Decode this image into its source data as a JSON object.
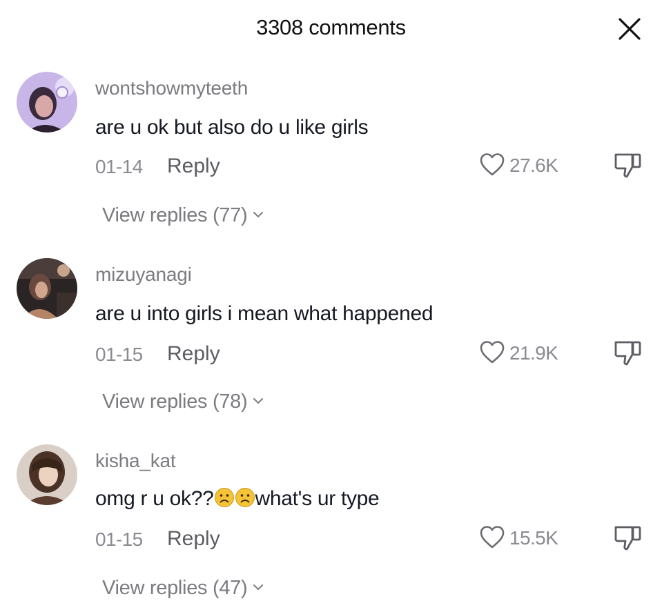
{
  "header": {
    "title": "3308 comments",
    "close_icon": "close-icon"
  },
  "comments": [
    {
      "username": "wontshowmyteeth",
      "text": "are u ok but also do u like girls",
      "date": "01-14",
      "reply_label": "Reply",
      "likes": "27.6K",
      "view_replies": "View replies (77)",
      "avatar_icon": "avatar-photo"
    },
    {
      "username": "mizuyanagi",
      "text": "are u into girls i mean what happened",
      "date": "01-15",
      "reply_label": "Reply",
      "likes": "21.9K",
      "view_replies": "View replies (78)",
      "avatar_icon": "avatar-photo"
    },
    {
      "username": "kisha_kat",
      "text_before": "omg r u ok??",
      "emojis": [
        "frowning-face-emoji",
        "frowning-face-emoji"
      ],
      "text_after": "what's ur type",
      "date": "01-15",
      "reply_label": "Reply",
      "likes": "15.5K",
      "view_replies": "View replies (47)",
      "avatar_icon": "avatar-photo"
    }
  ],
  "icons": {
    "like": "heart-icon",
    "dislike": "thumbs-down-icon",
    "expand": "chevron-down-icon"
  },
  "colors": {
    "text_primary": "#161823",
    "text_secondary": "#8a8b91",
    "background": "#ffffff"
  }
}
